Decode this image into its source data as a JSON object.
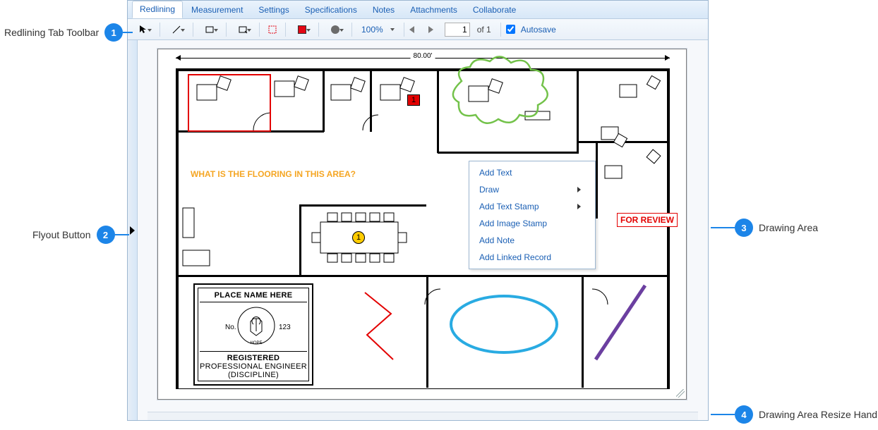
{
  "tabs": [
    "Redlining",
    "Measurement",
    "Settings",
    "Specifications",
    "Notes",
    "Attachments",
    "Collaborate"
  ],
  "active_tab": 0,
  "toolbar": {
    "zoom": "100%",
    "page_current": "1",
    "page_total_label": "of  1",
    "autosave_label": "Autosave",
    "autosave_checked": true,
    "fill_color": "#e30613",
    "shape_color": "#6b6b6b"
  },
  "drawing": {
    "dimension_label": "80.00'",
    "orange_text": "WHAT IS THE FLOORING IN THIS AREA?",
    "red_note_number": "1",
    "yellow_badge_number": "1",
    "review_label": "FOR REVIEW",
    "stamp": {
      "line1": "PLACE NAME HERE",
      "no_label": "No.",
      "no_value": "123",
      "line3": "REGISTERED",
      "line4": "PROFESSIONAL ENGINEER",
      "line5": "(DISCIPLINE)",
      "seal_word": "HOPE"
    }
  },
  "context_menu": {
    "items": [
      {
        "label": "Add Text",
        "sub": false
      },
      {
        "label": "Draw",
        "sub": true
      },
      {
        "label": "Add Text Stamp",
        "sub": true
      },
      {
        "label": "Add Image Stamp",
        "sub": false
      },
      {
        "label": "Add Note",
        "sub": false
      },
      {
        "label": "Add Linked Record",
        "sub": false
      }
    ]
  },
  "callouts": {
    "c1": "Redlining Tab Toolbar",
    "c2": "Flyout Button",
    "c3": "Drawing Area",
    "c4": "Drawing Area Resize Handle",
    "n1": "1",
    "n2": "2",
    "n3": "3",
    "n4": "4"
  }
}
